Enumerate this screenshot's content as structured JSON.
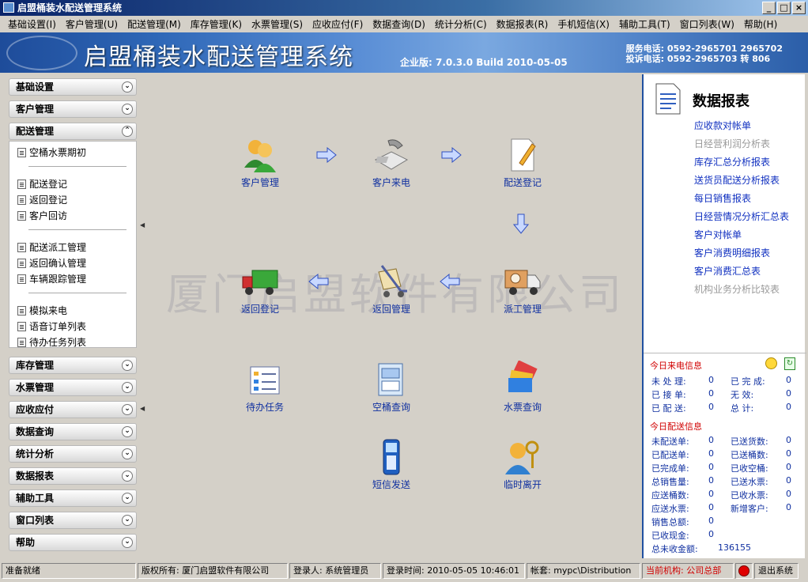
{
  "window": {
    "title": "启盟桶装水配送管理系统",
    "btn_min": "_",
    "btn_max": "□",
    "btn_close": "×"
  },
  "menubar": [
    "基础设置(I)",
    "客户管理(U)",
    "配送管理(M)",
    "库存管理(K)",
    "水票管理(S)",
    "应收应付(F)",
    "数据查询(D)",
    "统计分析(C)",
    "数据报表(R)",
    "手机短信(X)",
    "辅助工具(T)",
    "窗口列表(W)",
    "帮助(H)"
  ],
  "banner": {
    "title": "启盟桶装水配送管理系统",
    "version": "企业版: 7.0.3.0 Build 2010-05-05",
    "service_phone": "服务电话: 0592-2965701 2965702",
    "complaint_phone": "投诉电话: 0592-2965703 转 806"
  },
  "sidebar": {
    "groups_top": [
      "基础设置",
      "客户管理",
      "配送管理"
    ],
    "expanded_items": [
      {
        "label": "空桶水票期初"
      },
      {
        "label": "配送登记"
      },
      {
        "label": "返回登记"
      },
      {
        "label": "客户回访"
      },
      {
        "label": "配送派工管理"
      },
      {
        "label": "返回确认管理"
      },
      {
        "label": "车辆跟踪管理"
      },
      {
        "label": "模拟来电"
      },
      {
        "label": "语音订单列表"
      },
      {
        "label": "待办任务列表"
      }
    ],
    "groups_bottom": [
      "库存管理",
      "水票管理",
      "应收应付",
      "数据查询",
      "统计分析",
      "数据报表",
      "辅助工具",
      "窗口列表",
      "帮助"
    ]
  },
  "main": {
    "watermark": "厦门启盟软件有限公司",
    "items": {
      "customer": "客户管理",
      "call": "客户来电",
      "delivery_reg": "配送登记",
      "dispatch": "派工管理",
      "return_mgmt": "返回管理",
      "return_reg": "返回登记",
      "todo": "待办任务",
      "bucket_query": "空桶查询",
      "ticket_query": "水票查询",
      "sms": "短信发送",
      "leave": "临时离开"
    }
  },
  "reports": {
    "title": "数据报表",
    "links": [
      {
        "label": "应收款对帐单",
        "enabled": true
      },
      {
        "label": "日经营利润分析表",
        "enabled": false
      },
      {
        "label": "库存汇总分析报表",
        "enabled": true
      },
      {
        "label": "送货员配送分析报表",
        "enabled": true
      },
      {
        "label": "每日销售报表",
        "enabled": true
      },
      {
        "label": "日经营情况分析汇总表",
        "enabled": true
      },
      {
        "label": "客户对帐单",
        "enabled": true
      },
      {
        "label": "客户消费明细报表",
        "enabled": true
      },
      {
        "label": "客户消费汇总表",
        "enabled": true
      },
      {
        "label": "机构业务分析比较表",
        "enabled": false
      }
    ]
  },
  "today_calls": {
    "title": "今日来电信息",
    "rows": [
      [
        "未 处 理:",
        "0",
        "已 完 成:",
        "0"
      ],
      [
        "已 接 单:",
        "0",
        "无    效:",
        "0"
      ],
      [
        "已 配 送:",
        "0",
        "总    计:",
        "0"
      ]
    ]
  },
  "today_delivery": {
    "title": "今日配送信息",
    "rows": [
      [
        "未配送单:",
        "0",
        "已送货数:",
        "0"
      ],
      [
        "已配送单:",
        "0",
        "已送桶数:",
        "0"
      ],
      [
        "已完成单:",
        "0",
        "已收空桶:",
        "0"
      ],
      [
        "总销售量:",
        "0",
        "已送水票:",
        "0"
      ],
      [
        "应送桶数:",
        "0",
        "已收水票:",
        "0"
      ],
      [
        "应送水票:",
        "0",
        "新增客户:",
        "0"
      ]
    ],
    "sales_total_label": "销售总额:",
    "sales_total": "0",
    "cash_label": "已收现金:",
    "cash": "0",
    "unpaid_label": "总未收金额:",
    "unpaid": "136155"
  },
  "statusbar": {
    "ready": "准备就绪",
    "copyright": "版权所有: 厦门启盟软件有限公司",
    "login_user": "登录人: 系统管理员",
    "login_time": "登录时间: 2010-05-05 10:46:01",
    "account": "帐套: mypc\\Distribution",
    "current_org": "当前机构: 公司总部",
    "exit": "退出系统"
  }
}
